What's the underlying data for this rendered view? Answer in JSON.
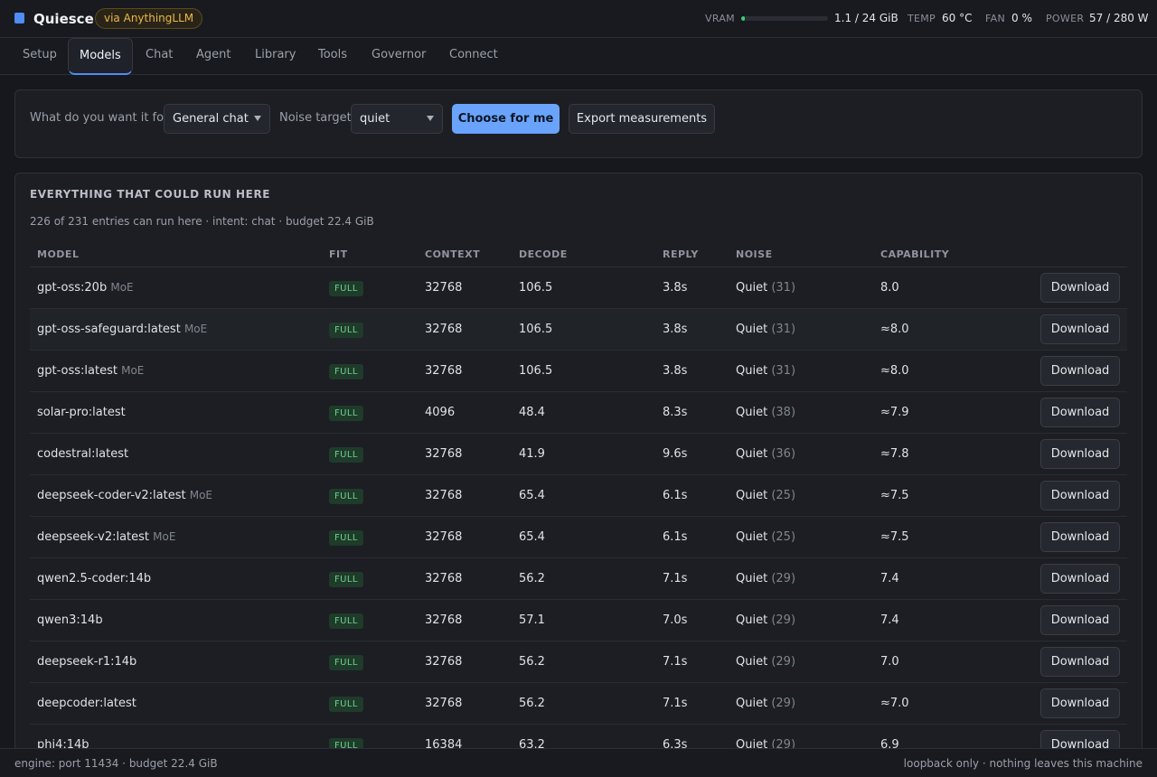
{
  "header": {
    "app_name": "Quiesce",
    "via_badge": "via AnythingLLM",
    "vram_label": "VRAM",
    "vram_value": "1.1 / 24 GiB",
    "vram_fraction": 0.046,
    "temp_label": "TEMP",
    "temp_value": "60 °C",
    "fan_label": "FAN",
    "fan_value": "0 %",
    "power_label": "POWER",
    "power_value": "57 / 280 W",
    "accent_color": "#4f8cf5"
  },
  "tabs": [
    {
      "label": "Setup"
    },
    {
      "label": "Models",
      "active": true
    },
    {
      "label": "Chat"
    },
    {
      "label": "Agent"
    },
    {
      "label": "Library"
    },
    {
      "label": "Tools"
    },
    {
      "label": "Governor"
    },
    {
      "label": "Connect"
    }
  ],
  "controls": {
    "intent_label": "What do you want it for?",
    "intent_value": "General chat",
    "noise_label": "Noise target",
    "noise_value": "quiet",
    "choose_button": "Choose for me",
    "export_button": "Export measurements"
  },
  "catalog": {
    "title": "EVERYTHING THAT COULD RUN HERE",
    "summary": "226 of 231 entries can run here · intent: chat · budget 22.4 GiB",
    "columns": {
      "model": "MODEL",
      "fit": "FIT",
      "context": "CONTEXT",
      "decode": "DECODE",
      "reply": "REPLY",
      "noise": "NOISE",
      "capability": "CAPABILITY"
    },
    "rows": [
      {
        "name": "gpt-oss:20b",
        "tag": "MoE",
        "fit": "FULL",
        "context": "32768",
        "decode": "106.5",
        "reply": "3.8s",
        "noise": "Quiet",
        "noise_score": "(31)",
        "capability": "8.0",
        "action": "Download"
      },
      {
        "name": "gpt-oss-safeguard:latest",
        "tag": "MoE",
        "fit": "FULL",
        "context": "32768",
        "decode": "106.5",
        "reply": "3.8s",
        "noise": "Quiet",
        "noise_score": "(31)",
        "capability": "≈8.0",
        "action": "Download"
      },
      {
        "name": "gpt-oss:latest",
        "tag": "MoE",
        "fit": "FULL",
        "context": "32768",
        "decode": "106.5",
        "reply": "3.8s",
        "noise": "Quiet",
        "noise_score": "(31)",
        "capability": "≈8.0",
        "action": "Download"
      },
      {
        "name": "solar-pro:latest",
        "tag": "",
        "fit": "FULL",
        "context": "4096",
        "decode": "48.4",
        "reply": "8.3s",
        "noise": "Quiet",
        "noise_score": "(38)",
        "capability": "≈7.9",
        "action": "Download"
      },
      {
        "name": "codestral:latest",
        "tag": "",
        "fit": "FULL",
        "context": "32768",
        "decode": "41.9",
        "reply": "9.6s",
        "noise": "Quiet",
        "noise_score": "(36)",
        "capability": "≈7.8",
        "action": "Download"
      },
      {
        "name": "deepseek-coder-v2:latest",
        "tag": "MoE",
        "fit": "FULL",
        "context": "32768",
        "decode": "65.4",
        "reply": "6.1s",
        "noise": "Quiet",
        "noise_score": "(25)",
        "capability": "≈7.5",
        "action": "Download"
      },
      {
        "name": "deepseek-v2:latest",
        "tag": "MoE",
        "fit": "FULL",
        "context": "32768",
        "decode": "65.4",
        "reply": "6.1s",
        "noise": "Quiet",
        "noise_score": "(25)",
        "capability": "≈7.5",
        "action": "Download"
      },
      {
        "name": "qwen2.5-coder:14b",
        "tag": "",
        "fit": "FULL",
        "context": "32768",
        "decode": "56.2",
        "reply": "7.1s",
        "noise": "Quiet",
        "noise_score": "(29)",
        "capability": "7.4",
        "action": "Download"
      },
      {
        "name": "qwen3:14b",
        "tag": "",
        "fit": "FULL",
        "context": "32768",
        "decode": "57.1",
        "reply": "7.0s",
        "noise": "Quiet",
        "noise_score": "(29)",
        "capability": "7.4",
        "action": "Download"
      },
      {
        "name": "deepseek-r1:14b",
        "tag": "",
        "fit": "FULL",
        "context": "32768",
        "decode": "56.2",
        "reply": "7.1s",
        "noise": "Quiet",
        "noise_score": "(29)",
        "capability": "7.0",
        "action": "Download"
      },
      {
        "name": "deepcoder:latest",
        "tag": "",
        "fit": "FULL",
        "context": "32768",
        "decode": "56.2",
        "reply": "7.1s",
        "noise": "Quiet",
        "noise_score": "(29)",
        "capability": "≈7.0",
        "action": "Download"
      },
      {
        "name": "phi4:14b",
        "tag": "",
        "fit": "FULL",
        "context": "16384",
        "decode": "63.2",
        "reply": "6.3s",
        "noise": "Quiet",
        "noise_score": "(29)",
        "capability": "6.9",
        "action": "Download"
      }
    ]
  },
  "footer": {
    "left": "engine: port 11434 · budget 22.4 GiB",
    "right": "loopback only · nothing leaves this machine"
  }
}
